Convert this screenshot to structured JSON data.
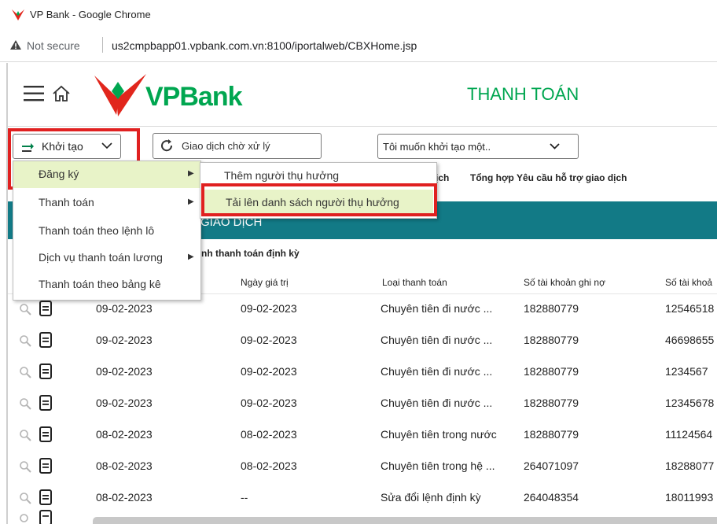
{
  "window": {
    "title": "VP Bank - Google Chrome"
  },
  "address": {
    "security": "Not secure",
    "url": "us2cmpbapp01.vpbank.com.vn:8100/iportalweb/CBXHome.jsp"
  },
  "header": {
    "logo": "VPBank",
    "page_title": "THANH TOÁN"
  },
  "toolbar": {
    "create_label": "Khởi tạo",
    "pending_label": "Giao dịch chờ xử lý",
    "quick_select": "Tôi muốn khởi tạo một..",
    "links": [
      "ịch",
      "Tổng hợp Yêu cầu hỗ trợ giao dịch"
    ]
  },
  "menu": {
    "items": [
      "Đăng ký",
      "Thanh toán",
      "Thanh toán theo lệnh lô",
      "Dịch vụ thanh toán lương",
      "Thanh toán theo bảng kê"
    ],
    "submenu": [
      "Thêm người thụ hưởng",
      "Tải lên danh sách người thụ hưởng"
    ]
  },
  "section": {
    "banner": "GIAO DỊCH",
    "subtab": "nh thanh toán định kỳ"
  },
  "table": {
    "headers": [
      "Ngày giá trị",
      "Loại thanh toán",
      "Số tài khoản ghi nợ",
      "Số tài khoả"
    ],
    "rows": [
      [
        "09-02-2023",
        "09-02-2023",
        "Chuyên tiên đi nước ...",
        "182880779",
        "12546518"
      ],
      [
        "09-02-2023",
        "09-02-2023",
        "Chuyên tiên đi nước ...",
        "182880779",
        "46698655"
      ],
      [
        "09-02-2023",
        "09-02-2023",
        "Chuyên tiên đi nước ...",
        "182880779",
        "1234567"
      ],
      [
        "09-02-2023",
        "09-02-2023",
        "Chuyên tiên đi nước ...",
        "182880779",
        "12345678"
      ],
      [
        "08-02-2023",
        "08-02-2023",
        "Chuyên tiên trong nước",
        "182880779",
        "11124564"
      ],
      [
        "08-02-2023",
        "08-02-2023",
        "Chuyên tiên trong hệ ...",
        "264071097",
        "18288077"
      ],
      [
        "08-02-2023",
        "--",
        "Sửa đổi lệnh định kỳ",
        "264048354",
        "18011993"
      ]
    ]
  },
  "colors": {
    "brand_red": "#e1261c",
    "brand_green": "#00a650",
    "banner_teal": "#127a86",
    "highlight": "#e8f3c8"
  }
}
